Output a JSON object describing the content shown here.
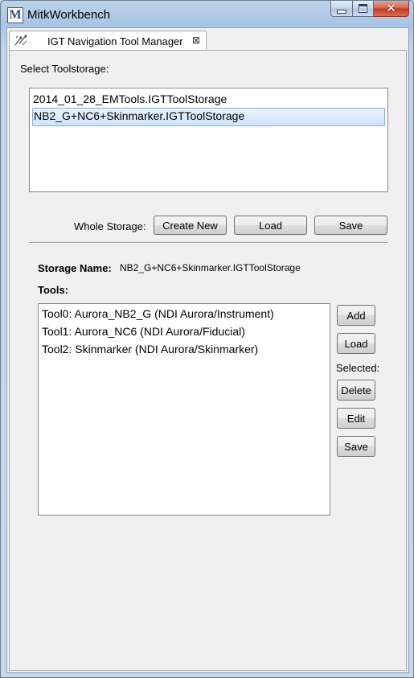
{
  "window": {
    "title": "MitkWorkbench",
    "app_icon_letter": "M",
    "icons": {
      "app": "mitk-logo-icon",
      "minimize": "minimize-icon",
      "maximize": "maximize-icon",
      "close": "close-icon"
    }
  },
  "tab": {
    "label": "IGT Navigation Tool Manager",
    "close_glyph": "⊠",
    "icon": "igt-navigation-icon"
  },
  "toolstorage": {
    "select_label": "Select Toolstorage:",
    "items": [
      {
        "label": "2014_01_28_EMTools.IGTToolStorage",
        "selected": false
      },
      {
        "label": "NB2_G+NC6+Skinmarker.IGTToolStorage",
        "selected": true
      }
    ],
    "whole_storage_label": "Whole Storage:",
    "create_new_label": "Create New",
    "load_label": "Load",
    "save_label": "Save"
  },
  "storage": {
    "name_label": "Storage Name:",
    "name_value": "NB2_G+NC6+Skinmarker.IGTToolStorage",
    "tools_label": "Tools:",
    "tools": [
      {
        "label": "Tool0: Aurora_NB2_G (NDI Aurora/Instrument)"
      },
      {
        "label": "Tool1: Aurora_NC6 (NDI Aurora/Fiducial)"
      },
      {
        "label": "Tool2: Skinmarker (NDI Aurora/Skinmarker)"
      }
    ],
    "add_label": "Add",
    "load_label": "Load",
    "selected_label": "Selected:",
    "delete_label": "Delete",
    "edit_label": "Edit",
    "save_label": "Save"
  },
  "colors": {
    "selection": "#cfe4fb",
    "selection_border": "#84acdd",
    "close_button": "#c2381e"
  }
}
